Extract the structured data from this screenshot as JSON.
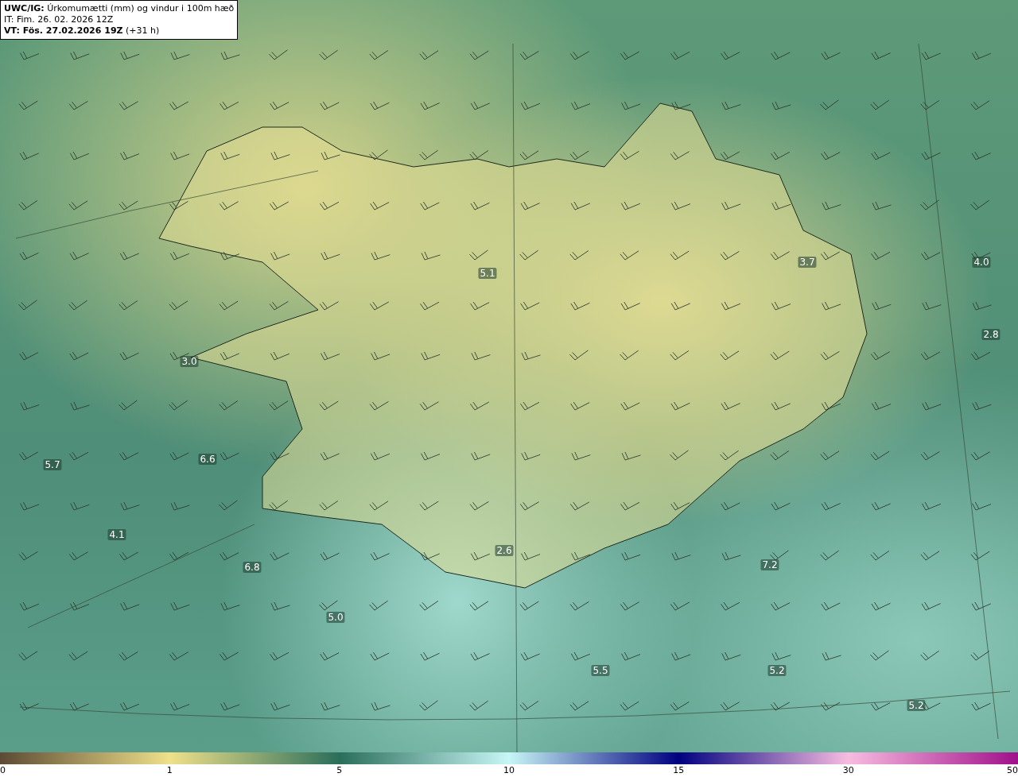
{
  "header": {
    "title": "**UWC/IG:** Úrkomumætti (mm) og vindur i 100m hæð",
    "issue_time": "IT: Fim. 26. 02. 2026 12Z",
    "valid_time": "**VT: Fös. 27.02.2026 19Z** (+31 h)"
  },
  "map_values": [
    "3.7",
    "4.0",
    "5.1",
    "2.8",
    "3.0",
    "5.7",
    "6.6",
    "4.1",
    "6.8",
    "2.6",
    "7.2",
    "5.0",
    "5.5",
    "5.2",
    "5.2"
  ],
  "colorbar": {
    "ticks": [
      "0",
      "1",
      "5",
      "10",
      "15",
      "30",
      "50"
    ]
  }
}
